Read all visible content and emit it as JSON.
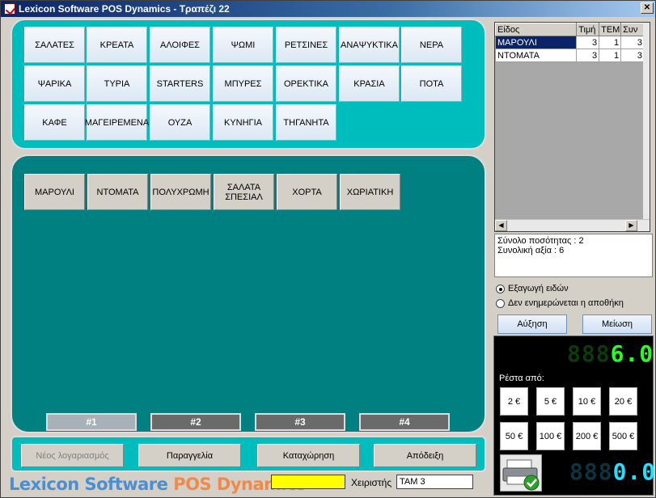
{
  "window": {
    "title": "Lexicon Software POS Dynamics - Τραπέζι 22",
    "close_glyph": "✕"
  },
  "categories": [
    "ΣΑΛΑΤΕΣ",
    "ΚΡΕΑΤΑ",
    "ΑΛΟΙΦΕΣ",
    "ΨΩΜΙ",
    "ΡΕΤΣΙΝΕΣ",
    "ΑΝΑΨΥΚΤΙΚΑ",
    "ΝΕΡΑ",
    "ΨΑΡΙΚΑ",
    "ΤΥΡΙΑ",
    "STARTERS",
    "ΜΠΥΡΕΣ",
    "ΟΡΕΚΤΙΚΑ",
    "ΚΡΑΣΙΑ",
    "ΠΟΤΑ",
    "ΚΑΦΕ",
    "ΜΑΓΕΙΡΕΜΕΝΑ",
    "ΟΥΖΑ",
    "ΚΥΝΗΓΙΑ",
    "ΤΗΓΑΝΗΤΑ"
  ],
  "items": [
    "ΜΑΡΟΥΛΙ",
    "ΝΤΟΜΑΤΑ",
    "ΠΟΛΥΧΡΩΜΗ",
    "ΣΑΛΑΤΑ ΣΠΕΣΙΑΛ",
    "ΧΟΡΤΑ",
    "ΧΩΡΙΑΤΙΚΗ"
  ],
  "pages": [
    "#1",
    "#2",
    "#3",
    "#4"
  ],
  "active_page": "#1",
  "actions": {
    "new_account": "Νέος λογαριασμός",
    "order": "Παραγγελία",
    "register": "Καταχώρηση",
    "receipt": "Απόδειξη"
  },
  "brand": {
    "part1": "Lexicon Software ",
    "part2": "POS Dynamics"
  },
  "operator": {
    "label": "Χειριστής",
    "value": "ΤΑΜ 3"
  },
  "order_grid": {
    "columns": [
      "Είδος",
      "Τιμή",
      "ΤΕΜ",
      "Συν"
    ],
    "rows": [
      {
        "name": "ΜΑΡΟΥΛΙ",
        "price": "3",
        "qty": "1",
        "total": "3"
      },
      {
        "name": "ΝΤΟΜΑΤΑ",
        "price": "3",
        "qty": "1",
        "total": "3"
      }
    ]
  },
  "summary": {
    "qty_line": "Σύνολο ποσότητας : 2",
    "value_line": "Συνολική αξία : 6"
  },
  "options": {
    "export_items": "Εξαγωγή ειδών",
    "no_stock_update": "Δεν ενημερώνεται η αποθήκη"
  },
  "qty_buttons": {
    "increase": "Αύξηση",
    "decrease": "Μείωση"
  },
  "total_display": {
    "ghost": "888",
    "value": "6.0"
  },
  "change": {
    "label": "Ρέστα από:",
    "denominations": [
      "2 €",
      "5 €",
      "10 €",
      "20 €",
      "50 €",
      "100 €",
      "200 €",
      "500 €"
    ],
    "display_ghost": "888",
    "display_value": "0.0"
  }
}
